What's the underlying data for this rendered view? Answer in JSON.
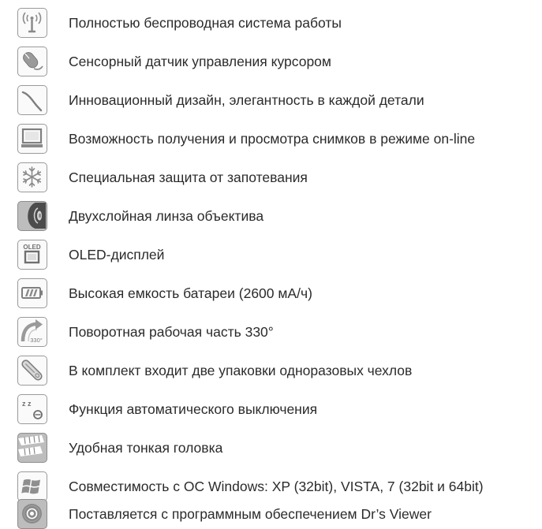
{
  "features": [
    {
      "icon": "wireless-icon",
      "text": "Полностью беспроводная система работы"
    },
    {
      "icon": "mouse-sensor-icon",
      "text": "Сенсорный датчик управления курсором"
    },
    {
      "icon": "design-curve-icon",
      "text": "Инновационный дизайн, элегантность в каждой детали"
    },
    {
      "icon": "monitor-icon",
      "text": "Возможность получения и просмотра снимков в режиме on-line"
    },
    {
      "icon": "snowflake-icon",
      "text": "Специальная защита от запотевания"
    },
    {
      "icon": "lens-icon",
      "text": "Двухслойная линза объектива"
    },
    {
      "icon": "oled-icon",
      "icon_text": "OLED",
      "text": "OLED-дисплей"
    },
    {
      "icon": "battery-icon",
      "text": "Высокая емкость батареи (2600 мА/ч)"
    },
    {
      "icon": "rotate-icon",
      "icon_text": "330°",
      "text": "Поворотная рабочая часть 330°"
    },
    {
      "icon": "disposable-cover-icon",
      "text": "В комплект входит две упаковки  одноразовых чехлов"
    },
    {
      "icon": "auto-off-icon",
      "icon_text": "z z",
      "text": "Функция автоматического выключения"
    },
    {
      "icon": "slim-head-icon",
      "text": "Удобная тонкая головка"
    },
    {
      "icon": "windows-icon",
      "text": "Совместимость с ОС Windows: XP (32bit), VISTA, 7 (32bit и 64bit)"
    },
    {
      "icon": "disc-icon",
      "text": "Поставляется с программным обеспечением Dr’s Viewer"
    }
  ]
}
